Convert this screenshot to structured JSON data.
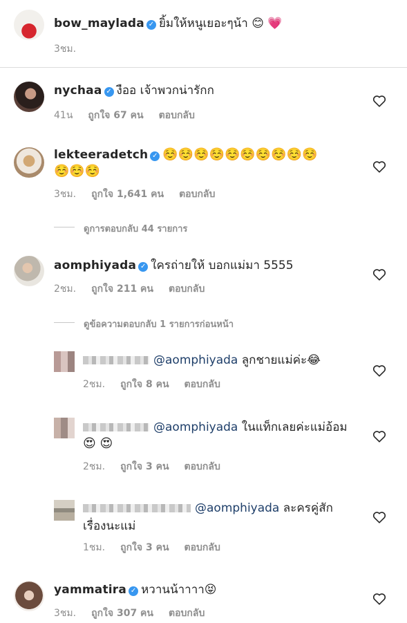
{
  "verified_mark": "✓",
  "caption": {
    "username": "bow_maylada",
    "text": "ยิ้มให้หนูเยอะๆน้า 😊 💗",
    "time": "3ชม."
  },
  "comments": [
    {
      "username": "nychaa",
      "text": "งืออ เจ้าพวกน่ารักก",
      "time": "41น",
      "likes": "ถูกใจ 67 คน",
      "reply": "ตอบกลับ"
    },
    {
      "username": "lekteeradetch",
      "text": "☺️☺️☺️☺️☺️☺️☺️☺️☺️☺️",
      "text_line2": "☺️☺️☺️",
      "time": "3ชม.",
      "likes": "ถูกใจ 1,641 คน",
      "reply": "ตอบกลับ",
      "view_replies": "ดูการตอบกลับ 44 รายการ"
    },
    {
      "username": "aomphiyada",
      "text": "ใครถ่ายให้ บอกแม่มา 5555",
      "time": "2ชม.",
      "likes": "ถูกใจ 211 คน",
      "reply": "ตอบกลับ",
      "view_previous": "ดูข้อความตอบกลับ 1 รายการก่อนหน้า"
    },
    {
      "username": "yammatira",
      "text": "หวานน้าาาา😝",
      "time": "3ชม.",
      "likes": "ถูกใจ 307 คน",
      "reply": "ตอบกลับ"
    }
  ],
  "replies": [
    {
      "mention": "@aomphiyada",
      "text": "ลูกชายแม่ค่ะ😂",
      "time": "2ชม.",
      "likes": "ถูกใจ 8 คน",
      "reply": "ตอบกลับ"
    },
    {
      "mention": "@aomphiyada",
      "text": "ในแท็กเลยค่ะแม่อ้อม",
      "text_line2": "😍 😍",
      "time": "2ชม.",
      "likes": "ถูกใจ 3 คน",
      "reply": "ตอบกลับ"
    },
    {
      "mention": "@aomphiyada",
      "text": "ละครคู่สัก",
      "text_line2": "เรื่องนะแม่",
      "time": "1ชม.",
      "likes": "ถูกใจ 3 คน",
      "reply": "ตอบกลับ"
    }
  ]
}
